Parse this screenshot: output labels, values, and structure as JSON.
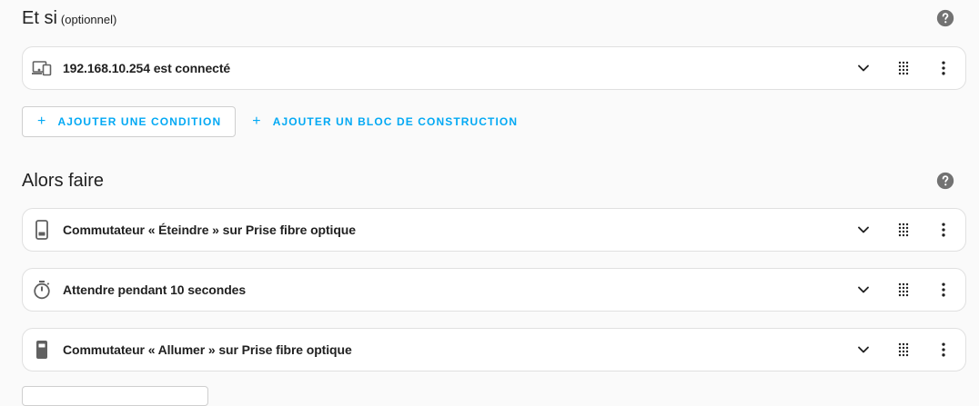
{
  "if_section": {
    "title": "Et si",
    "optional": "(optionnel)",
    "help_icon": "help-circle-icon",
    "conditions": [
      {
        "label": "192.168.10.254 est connecté",
        "icon": "devices-icon"
      }
    ],
    "add_condition_label": "AJOUTER UNE CONDITION",
    "add_block_label": "AJOUTER UN BLOC DE CONSTRUCTION"
  },
  "then_section": {
    "title": "Alors faire",
    "help_icon": "help-circle-icon",
    "actions": [
      {
        "label": "Commutateur « Éteindre » sur Prise fibre optique",
        "icon": "power-socket-off-icon"
      },
      {
        "label": "Attendre pendant 10 secondes",
        "icon": "timer-icon"
      },
      {
        "label": "Commutateur « Allumer » sur Prise fibre optique",
        "icon": "power-socket-on-icon"
      }
    ]
  },
  "card_actions": {
    "expand_icon": "chevron-down-icon",
    "drag_icon": "drag-handle-icon",
    "menu_icon": "more-vertical-icon"
  },
  "colors": {
    "accent": "#03a9f4",
    "icon": "#616161",
    "help": "#727272",
    "border": "#e0e0e0"
  }
}
